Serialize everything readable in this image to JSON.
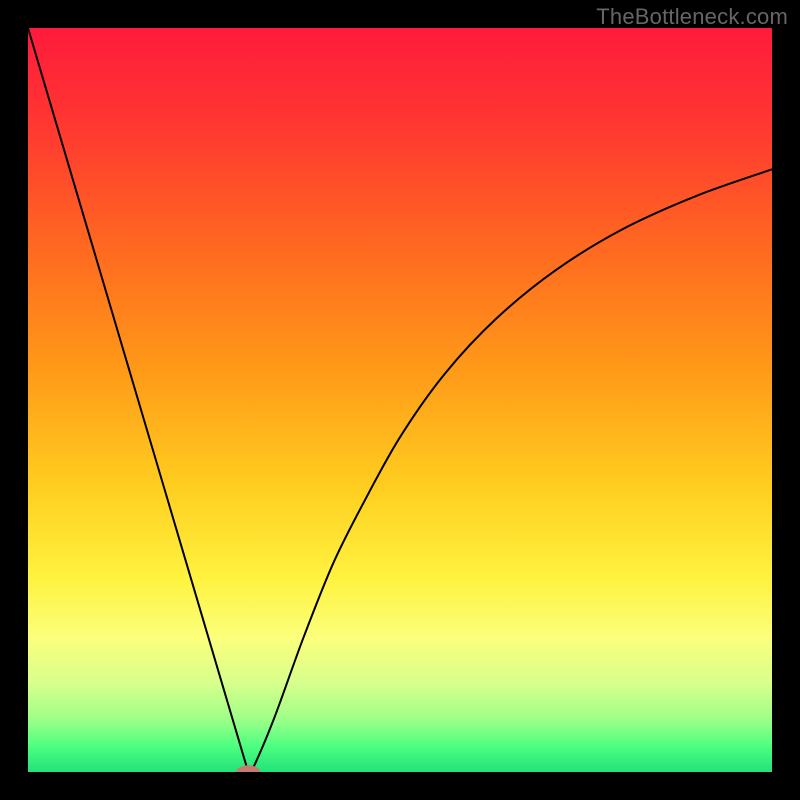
{
  "watermark": "TheBottleneck.com",
  "chart_data": {
    "type": "line",
    "title": "",
    "xlabel": "",
    "ylabel": "",
    "xlim": [
      0,
      100
    ],
    "ylim": [
      0,
      100
    ],
    "gradient_stops": [
      {
        "offset": 0.0,
        "color": "#ff1a3c"
      },
      {
        "offset": 0.14,
        "color": "#ff3a30"
      },
      {
        "offset": 0.3,
        "color": "#ff6a20"
      },
      {
        "offset": 0.46,
        "color": "#ff9a18"
      },
      {
        "offset": 0.62,
        "color": "#ffcf20"
      },
      {
        "offset": 0.74,
        "color": "#fff340"
      },
      {
        "offset": 0.82,
        "color": "#fbff7c"
      },
      {
        "offset": 0.88,
        "color": "#d8ff8c"
      },
      {
        "offset": 0.93,
        "color": "#9cff88"
      },
      {
        "offset": 0.965,
        "color": "#4dff80"
      },
      {
        "offset": 1.0,
        "color": "#22e27a"
      }
    ],
    "series": [
      {
        "name": "bottleneck-curve",
        "x": [
          0.0,
          5.92,
          11.84,
          17.76,
          23.68,
          29.6,
          30.0,
          33.0,
          37.0,
          41.0,
          45.0,
          50.0,
          56.0,
          63.0,
          71.0,
          80.0,
          90.0,
          100.0
        ],
        "y": [
          100.0,
          80.0,
          60.0,
          40.0,
          20.0,
          0.0,
          0.0,
          7.0,
          18.0,
          28.0,
          36.0,
          45.0,
          53.5,
          61.0,
          67.5,
          73.0,
          77.5,
          81.0
        ]
      }
    ],
    "marker": {
      "x": 29.6,
      "y": 0.0,
      "color": "#c97a6e",
      "rx": 1.6,
      "ry": 0.9
    }
  }
}
